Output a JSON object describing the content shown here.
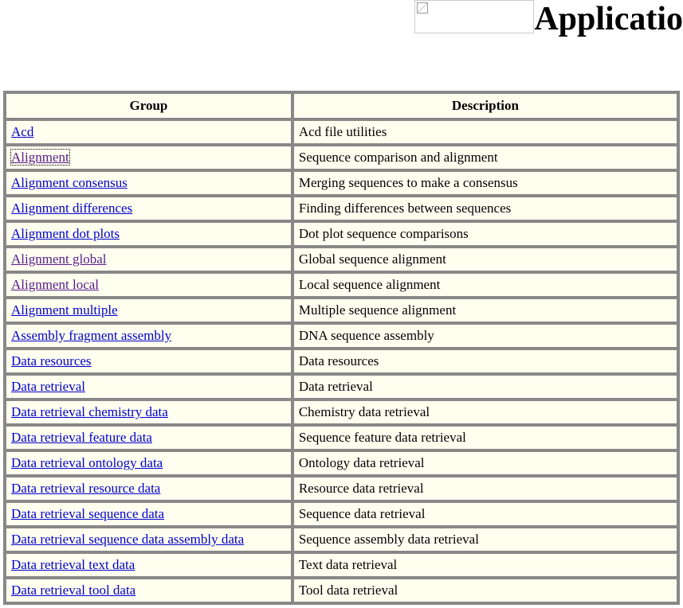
{
  "header": {
    "title": "Applicatio"
  },
  "table": {
    "headers": {
      "group": "Group",
      "description": "Description"
    },
    "rows": [
      {
        "group": "Acd",
        "description": "Acd file utilities",
        "visited": false,
        "focused": false
      },
      {
        "group": "Alignment",
        "description": "Sequence comparison and alignment",
        "visited": true,
        "focused": true
      },
      {
        "group": "Alignment consensus",
        "description": "Merging sequences to make a consensus",
        "visited": false,
        "focused": false
      },
      {
        "group": "Alignment differences",
        "description": "Finding differences between sequences",
        "visited": false,
        "focused": false
      },
      {
        "group": "Alignment dot plots",
        "description": "Dot plot sequence comparisons",
        "visited": false,
        "focused": false
      },
      {
        "group": "Alignment global",
        "description": "Global sequence alignment",
        "visited": true,
        "focused": false
      },
      {
        "group": "Alignment local",
        "description": "Local sequence alignment",
        "visited": true,
        "focused": false
      },
      {
        "group": "Alignment multiple",
        "description": "Multiple sequence alignment",
        "visited": false,
        "focused": false
      },
      {
        "group": "Assembly fragment assembly",
        "description": "DNA sequence assembly",
        "visited": false,
        "focused": false
      },
      {
        "group": "Data resources",
        "description": "Data resources",
        "visited": false,
        "focused": false
      },
      {
        "group": "Data retrieval",
        "description": "Data retrieval",
        "visited": false,
        "focused": false
      },
      {
        "group": "Data retrieval chemistry data",
        "description": "Chemistry data retrieval",
        "visited": false,
        "focused": false
      },
      {
        "group": "Data retrieval feature data",
        "description": "Sequence feature data retrieval",
        "visited": false,
        "focused": false
      },
      {
        "group": "Data retrieval ontology data",
        "description": "Ontology data retrieval",
        "visited": false,
        "focused": false
      },
      {
        "group": "Data retrieval resource data",
        "description": "Resource data retrieval",
        "visited": false,
        "focused": false
      },
      {
        "group": "Data retrieval sequence data",
        "description": "Sequence data retrieval",
        "visited": false,
        "focused": false
      },
      {
        "group": "Data retrieval sequence data assembly data",
        "description": "Sequence assembly data retrieval",
        "visited": false,
        "focused": false
      },
      {
        "group": "Data retrieval text data",
        "description": "Text data retrieval",
        "visited": false,
        "focused": false
      },
      {
        "group": "Data retrieval tool data",
        "description": "Tool data retrieval",
        "visited": false,
        "focused": false
      }
    ]
  }
}
